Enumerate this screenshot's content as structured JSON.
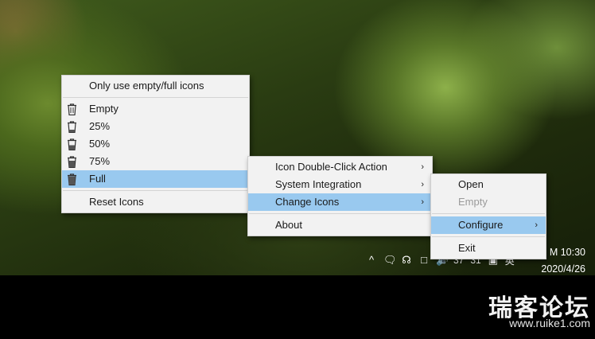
{
  "menu1": {
    "items": [
      {
        "label": "Only use empty/full icons",
        "icon": "",
        "selected": false
      },
      {
        "label": "Empty",
        "icon": "recycle-bin-empty-icon",
        "selected": false
      },
      {
        "label": "25%",
        "icon": "recycle-bin-25-icon",
        "selected": false
      },
      {
        "label": "50%",
        "icon": "recycle-bin-50-icon",
        "selected": false
      },
      {
        "label": "75%",
        "icon": "recycle-bin-75-icon",
        "selected": false
      },
      {
        "label": "Full",
        "icon": "recycle-bin-full-icon",
        "selected": true
      },
      {
        "label": "Reset Icons",
        "icon": "",
        "selected": false
      }
    ]
  },
  "menu2": {
    "items": [
      {
        "label": "Icon Double-Click Action",
        "submenu": true
      },
      {
        "label": "System Integration",
        "submenu": true
      },
      {
        "label": "Change Icons",
        "submenu": true,
        "selected": true
      },
      {
        "label": "About",
        "submenu": false
      }
    ]
  },
  "menu3": {
    "items": [
      {
        "label": "Open",
        "disabled": false
      },
      {
        "label": "Empty",
        "disabled": true
      },
      {
        "label": "Configure",
        "submenu": true,
        "selected": true
      },
      {
        "label": "Exit",
        "disabled": false
      }
    ]
  },
  "tray": {
    "chevron": "^",
    "num1": "37",
    "num2": "31",
    "ime": "英"
  },
  "clock": {
    "time": "M 10:30",
    "date": "2020/4/26"
  },
  "watermark": {
    "title": "瑞客论坛",
    "url": "www.ruike1.com"
  },
  "colors": {
    "menu_bg": "#f2f2f2",
    "highlight": "#99c9ef",
    "disabled_text": "#9a9a9a",
    "taskbar": "#000000"
  }
}
